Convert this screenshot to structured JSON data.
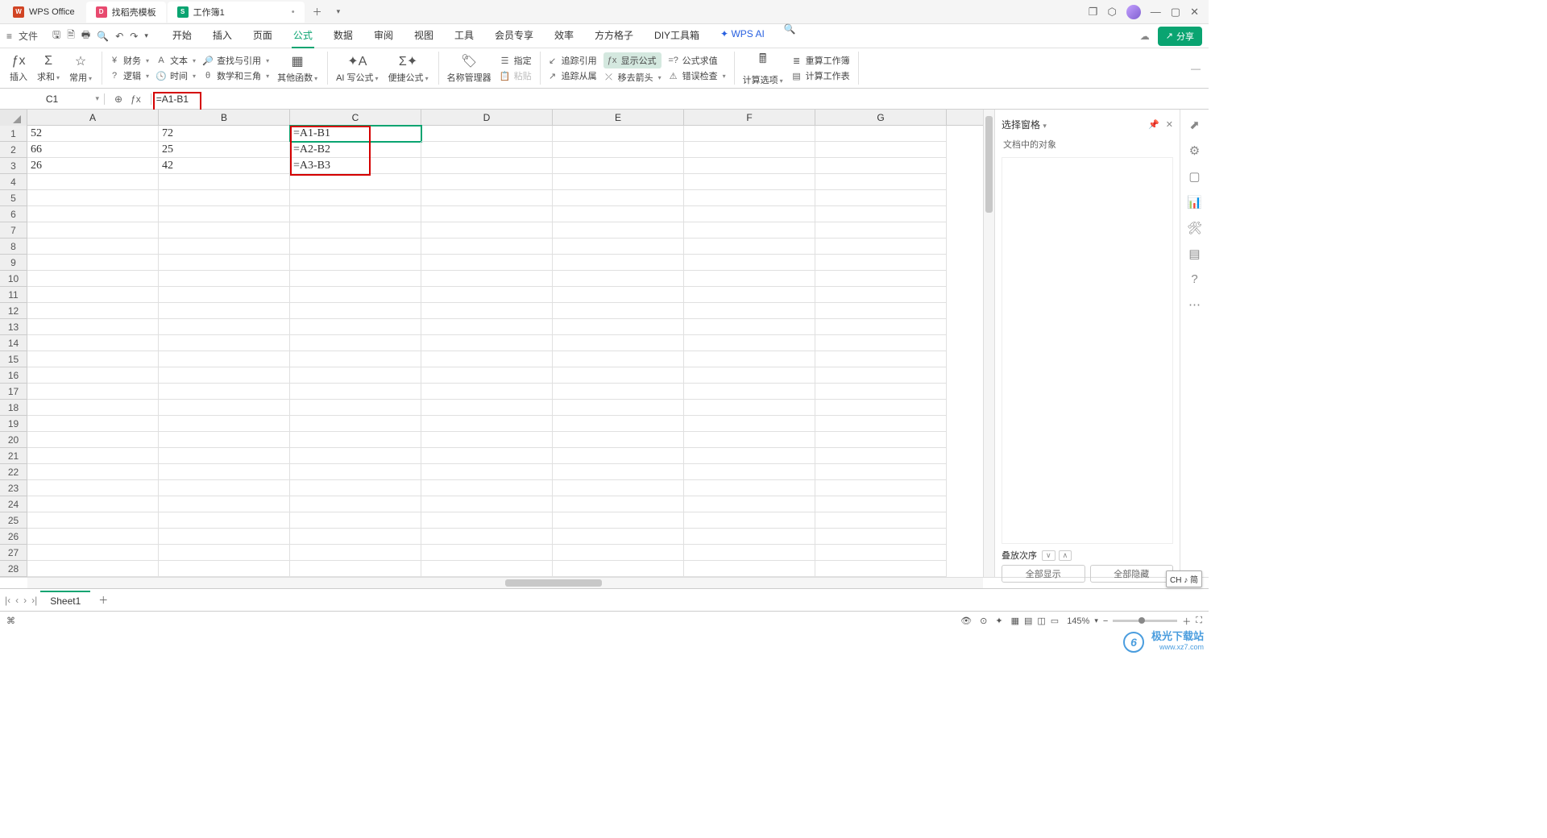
{
  "topTabs": {
    "home": "WPS Office",
    "templates": "找稻壳模板",
    "workbook": "工作簿1"
  },
  "menu": {
    "file": "文件",
    "tabs": [
      "开始",
      "插入",
      "页面",
      "公式",
      "数据",
      "审阅",
      "视图",
      "工具",
      "会员专享",
      "效率",
      "方方格子",
      "DIY工具箱"
    ],
    "activeIndex": 3,
    "ai": "WPS AI",
    "share": "分享"
  },
  "ribbon": {
    "insert": "插入",
    "sum": "求和",
    "common": "常用",
    "finance": "财务",
    "text": "文本",
    "lookup": "查找与引用",
    "logic": "逻辑",
    "time": "时间",
    "math": "数学和三角",
    "other": "其他函数",
    "aiFormula": "AI 写公式",
    "convenient": "便捷公式",
    "nameMgr": "名称管理器",
    "define": "指定",
    "paste": "粘贴",
    "trace": "追踪引用",
    "showFormula": "显示公式",
    "traceDep": "追踪从属",
    "removeArrow": "移去箭头",
    "evaluate": "公式求值",
    "errorCheck": "错误检查",
    "calcOptions": "计算选项",
    "recalc": "重算工作簿",
    "calcSheet": "计算工作表"
  },
  "formulaBar": {
    "cellRef": "C1",
    "formula": "=A1-B1"
  },
  "columns": [
    "A",
    "B",
    "C",
    "D",
    "E",
    "F",
    "G"
  ],
  "cells": {
    "A1": "52",
    "B1": "72",
    "C1": "=A1-B1",
    "A2": "66",
    "B2": "25",
    "C2": "=A2-B2",
    "A3": "26",
    "B3": "42",
    "C3": "=A3-B3"
  },
  "sidePanel": {
    "title": "选择窗格",
    "subtitle": "文档中的对象",
    "sort": "叠放次序",
    "showAll": "全部显示",
    "hideAll": "全部隐藏"
  },
  "sheetTabs": {
    "active": "Sheet1"
  },
  "statusBar": {
    "zoom": "145%",
    "ime": "CH ♪ 简"
  },
  "watermark": {
    "main": "极光下载站",
    "sub": "www.xz7.com"
  }
}
